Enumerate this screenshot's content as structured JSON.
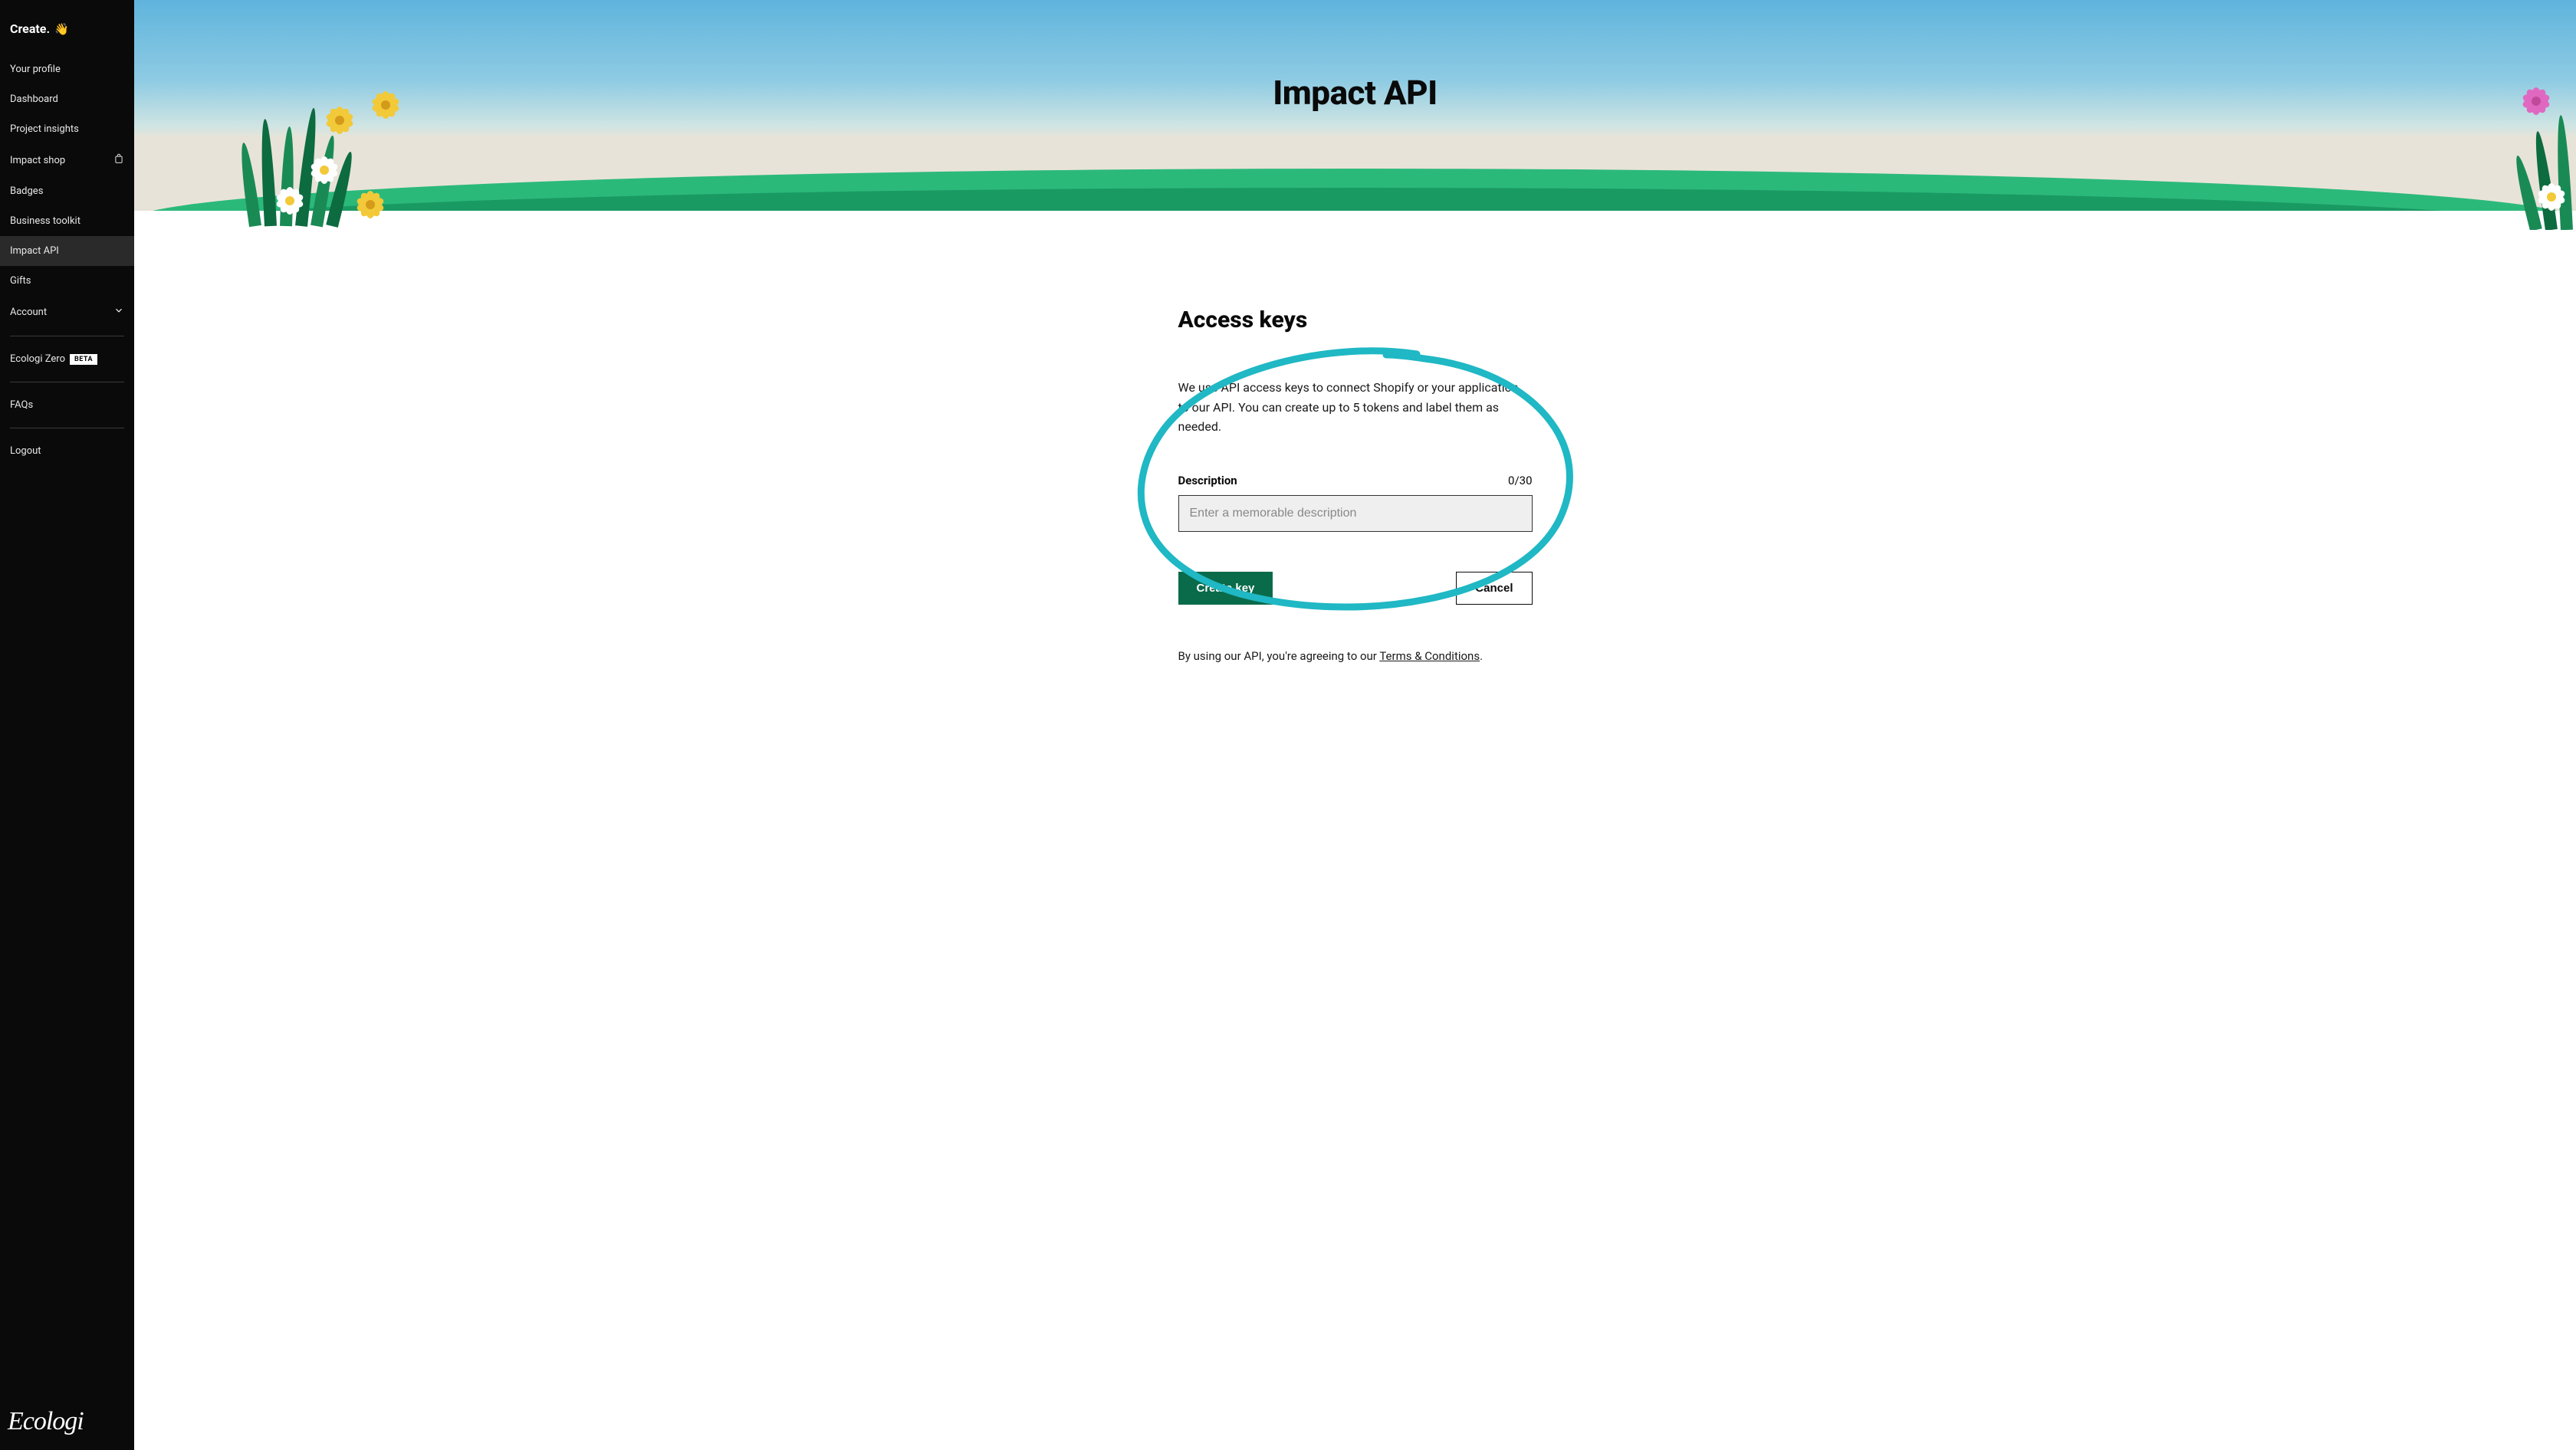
{
  "sidebar": {
    "header_prefix": "Create.",
    "items": [
      {
        "label": "Your profile"
      },
      {
        "label": "Dashboard"
      },
      {
        "label": "Project insights"
      },
      {
        "label": "Impact shop",
        "has_shop_icon": true
      },
      {
        "label": "Badges"
      },
      {
        "label": "Business toolkit"
      },
      {
        "label": "Impact API",
        "active": true
      },
      {
        "label": "Gifts"
      },
      {
        "label": "Account",
        "has_chevron": true
      }
    ],
    "zero_label": "Ecologi Zero",
    "zero_badge": "BETA",
    "faqs_label": "FAQs",
    "logout_label": "Logout",
    "brand": "Ecologi"
  },
  "hero": {
    "title": "Impact API"
  },
  "access": {
    "title": "Access keys",
    "description": "We use API access keys to connect Shopify or your application to our API. You can create up to 5 tokens and label them as needed.",
    "field_label": "Description",
    "counter": "0/30",
    "placeholder": "Enter a memorable description",
    "create_button": "Create key",
    "cancel_button": "Cancel",
    "footnote_prefix": "By using our API, you're agreeing to our ",
    "footnote_link": "Terms & Conditions",
    "footnote_suffix": "."
  },
  "colors": {
    "sidebar_bg": "#0a0a0a",
    "primary_green": "#0a6b4a",
    "highlight_teal": "#1fb8c4"
  }
}
